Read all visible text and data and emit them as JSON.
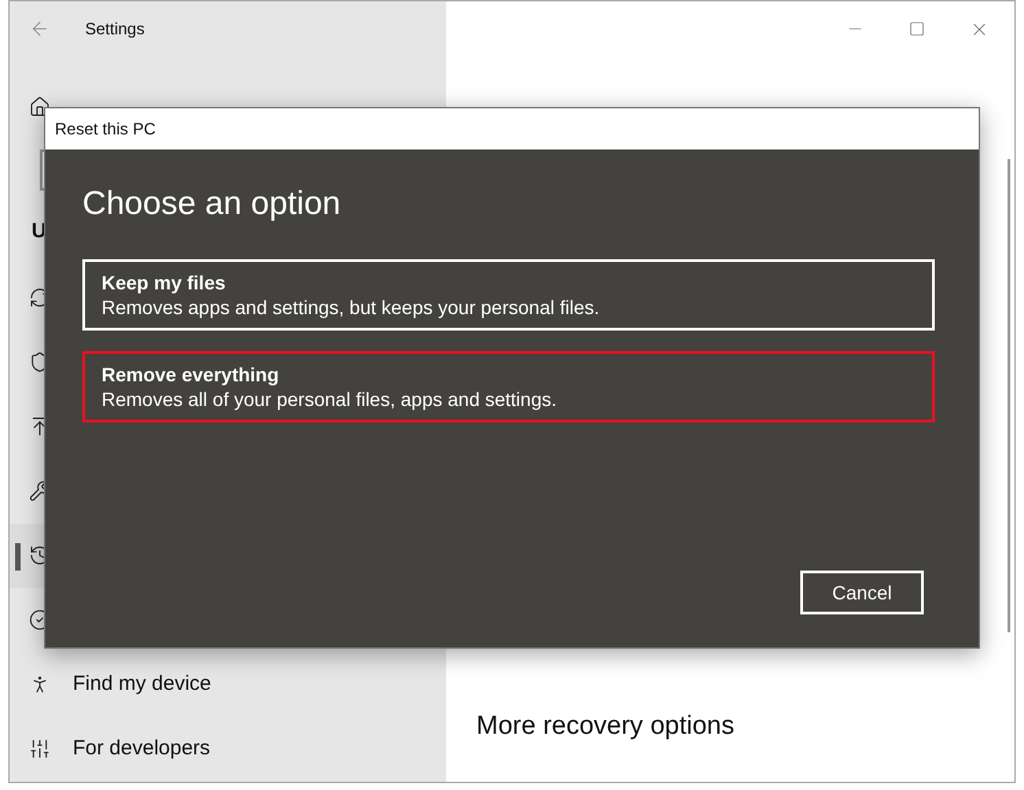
{
  "window": {
    "title": "Settings"
  },
  "sidebar": {
    "items": [
      {
        "kind": "item",
        "selected": false
      },
      {
        "kind": "search"
      },
      {
        "kind": "heading",
        "label": "U"
      },
      {
        "kind": "item",
        "selected": false
      },
      {
        "kind": "item",
        "selected": false
      },
      {
        "kind": "item",
        "selected": false
      },
      {
        "kind": "item",
        "selected": false
      },
      {
        "kind": "item",
        "selected": true
      },
      {
        "kind": "item",
        "selected": false
      },
      {
        "kind": "item",
        "label": "Find my device",
        "selected": false
      },
      {
        "kind": "item",
        "label": "For developers",
        "selected": false
      }
    ]
  },
  "page": {
    "section_heading": "More recovery options"
  },
  "dialog": {
    "title": "Reset this PC",
    "heading": "Choose an option",
    "options": [
      {
        "title": "Keep my files",
        "description": "Removes apps and settings, but keeps your personal files.",
        "selected": false
      },
      {
        "title": "Remove everything",
        "description": "Removes all of your personal files, apps and settings.",
        "selected": true
      }
    ],
    "cancel": "Cancel"
  }
}
